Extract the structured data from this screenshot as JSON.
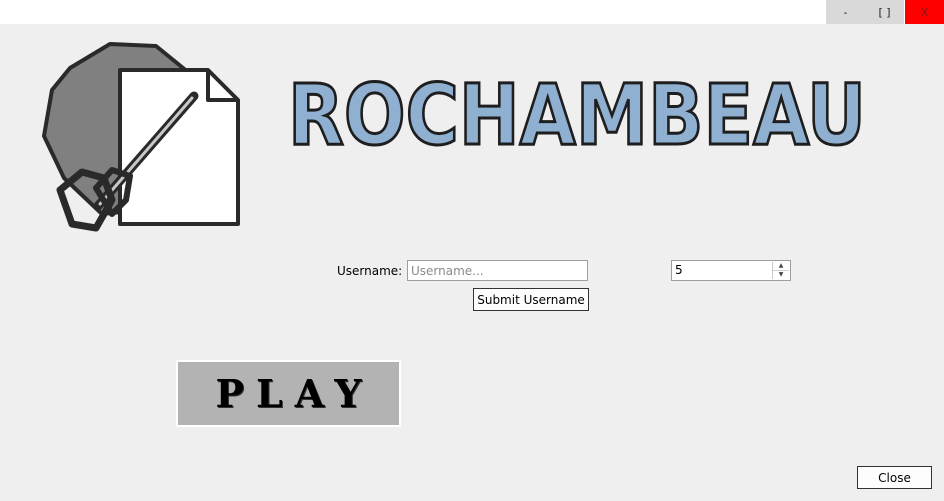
{
  "window": {
    "minimize_label": "-",
    "maximize_label": "[ ]",
    "close_label": "X",
    "close_color": "#ff0000"
  },
  "header": {
    "title": "ROCHAMBEAU",
    "title_color": "#8fb0d0",
    "logo_icon": "paper-scissors-rock-icon"
  },
  "form": {
    "username_label": "Username:",
    "username_value": "",
    "username_placeholder": "Username...",
    "rounds_value": "5",
    "submit_label": "Submit Username"
  },
  "play": {
    "label": "PLAY"
  },
  "footer": {
    "close_label": "Close"
  }
}
